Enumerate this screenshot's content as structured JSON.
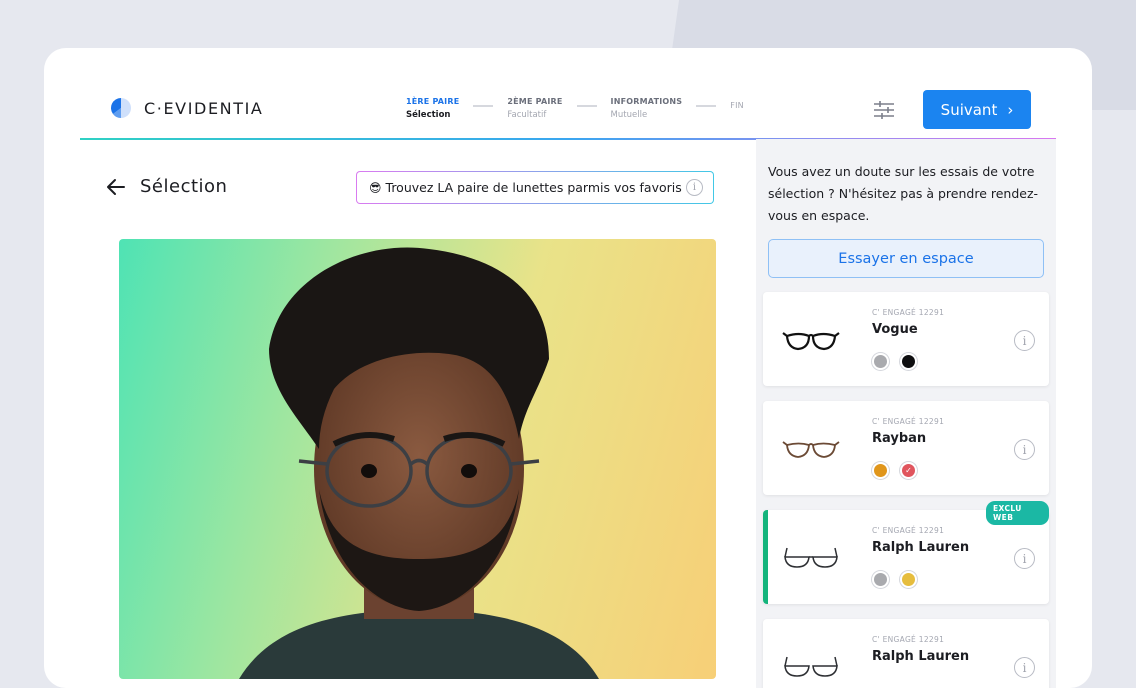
{
  "header": {
    "brand": "C·EVIDENTIA",
    "steps": [
      {
        "title": "1ÈRE PAIRE",
        "sub": "Sélection"
      },
      {
        "title": "2ÈME PAIRE",
        "sub": "Facultatif"
      },
      {
        "title": "INFORMATIONS",
        "sub": "Mutuelle"
      },
      {
        "title": "FIN",
        "sub": ""
      }
    ],
    "next_label": "Suivant",
    "next_icon": "›"
  },
  "main": {
    "back_icon": "arrow-left-icon",
    "title": "Sélection",
    "hint_emoji": "😎",
    "hint_text": "Trouvez LA paire de lunettes parmis vos favoris",
    "info_glyph": "i"
  },
  "panel": {
    "message": "Vous avez un doute sur les essais de votre sélection ? N'hésitez pas à prendre rendez-vous en espace.",
    "try_label": "Essayer en espace",
    "products": [
      {
        "code": "C' ENGAGÉ 12291",
        "name": "Vogue",
        "colors": [
          "#a9aaae",
          "#0e0e10"
        ],
        "selected_color": -1,
        "badge": ""
      },
      {
        "code": "C' ENGAGÉ 12291",
        "name": "Rayban",
        "colors": [
          "#e0961c",
          "#e0555e"
        ],
        "selected_color": 1,
        "badge": ""
      },
      {
        "code": "C' ENGAGÉ 12291",
        "name": "Ralph Lauren",
        "colors": [
          "#a9aaae",
          "#e6bd3e"
        ],
        "selected_color": -1,
        "badge": "EXCLU WEB"
      },
      {
        "code": "C' ENGAGÉ 12291",
        "name": "Ralph Lauren",
        "colors": [],
        "selected_color": -1,
        "badge": ""
      }
    ]
  },
  "colors": {
    "accent": "#1b84f0",
    "selected_bar": "#14b47c",
    "badge": "#1bb8a4"
  }
}
